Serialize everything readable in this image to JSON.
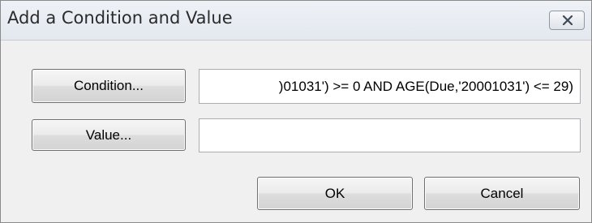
{
  "dialog": {
    "title": "Add a Condition and Value",
    "close_icon": "close-x-icon"
  },
  "condition": {
    "button_label": "Condition...",
    "value": ")01031') >= 0 AND AGE(Due,'20001031') <= 29)"
  },
  "value": {
    "button_label": "Value...",
    "value": ""
  },
  "actions": {
    "ok_label": "OK",
    "cancel_label": "Cancel"
  }
}
